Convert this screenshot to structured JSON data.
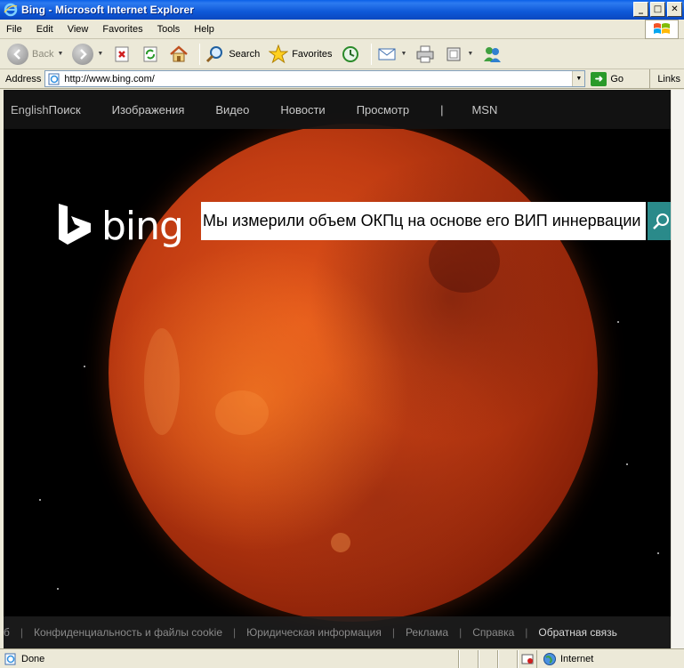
{
  "window": {
    "title": "Bing - Microsoft Internet Explorer"
  },
  "menu": [
    "File",
    "Edit",
    "View",
    "Favorites",
    "Tools",
    "Help"
  ],
  "toolbar": {
    "back": "Back",
    "search": "Search",
    "favorites": "Favorites"
  },
  "address": {
    "label": "Address",
    "url": "http://www.bing.com/",
    "go": "Go",
    "links": "Links"
  },
  "bing": {
    "nav": {
      "english": "English",
      "search": "Поиск",
      "images": "Изображения",
      "video": "Видео",
      "news": "Новости",
      "browse": "Просмотр",
      "sep": "|",
      "msn": "MSN"
    },
    "logo_text": "bing",
    "query": "Мы измерили объем ОКПц на основе его ВИП иннервации",
    "footer": {
      "partial": "б",
      "privacy": "Конфиденциальность и файлы cookie",
      "legal": "Юридическая информация",
      "ads": "Реклама",
      "help": "Справка",
      "feedback": "Обратная связь"
    }
  },
  "status": {
    "text": "Done",
    "zone": "Internet"
  },
  "colors": {
    "titlebar": "#0a5fe8",
    "chrome": "#ece9d8",
    "search_button": "#2a8a8a",
    "moon": "#c13c12"
  }
}
